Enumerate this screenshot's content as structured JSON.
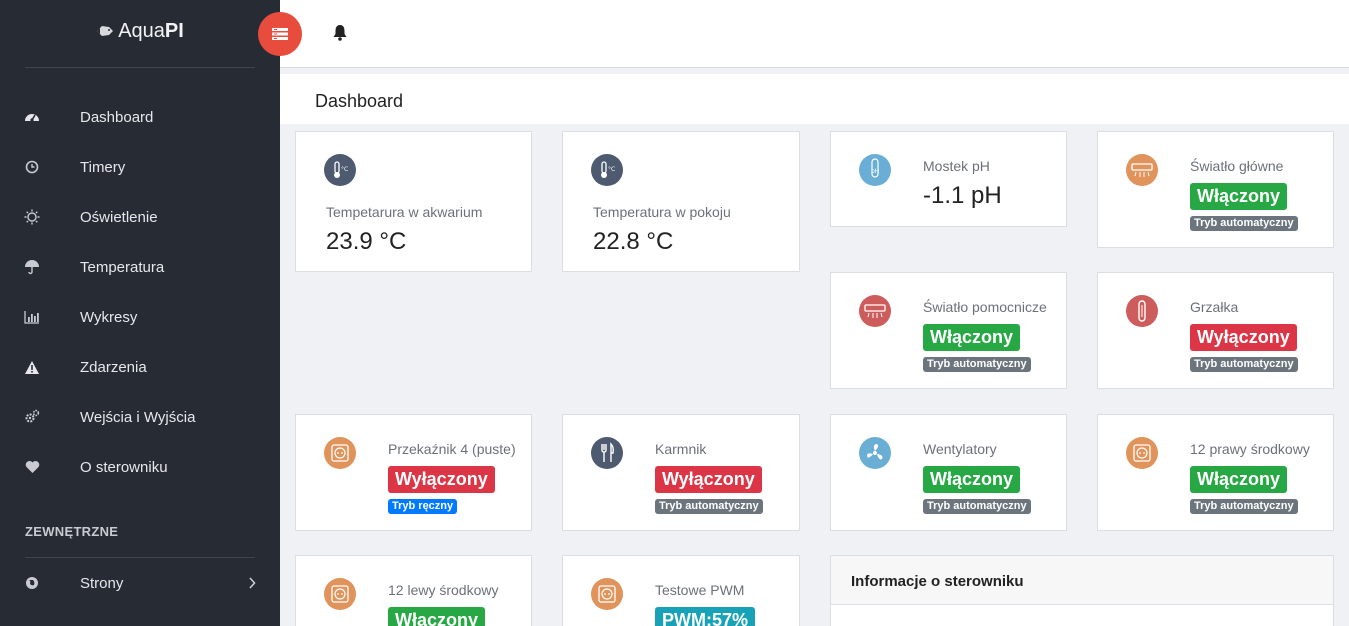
{
  "app": {
    "name_regular": "Aqua",
    "name_bold": "PI"
  },
  "sidebar": {
    "items": [
      {
        "label": "Dashboard",
        "icon": "gauge-icon"
      },
      {
        "label": "Timery",
        "icon": "clock-icon"
      },
      {
        "label": "Oświetlenie",
        "icon": "sun-icon"
      },
      {
        "label": "Temperatura",
        "icon": "umbrella-icon"
      },
      {
        "label": "Wykresy",
        "icon": "bar-chart-icon"
      },
      {
        "label": "Zdarzenia",
        "icon": "warning-icon"
      },
      {
        "label": "Wejścia i Wyjścia",
        "icon": "cogs-icon"
      },
      {
        "label": "O sterowniku",
        "icon": "heart-icon"
      }
    ],
    "section_title": "ZEWNĘTRZNE",
    "external_items": [
      {
        "label": "Strony",
        "icon": "globe-icon"
      }
    ]
  },
  "page": {
    "title": "Dashboard"
  },
  "colors": {
    "sidebar_bg": "#272b34",
    "accent": "#e74c3c",
    "on": "#28a745",
    "off": "#dc3545",
    "pwm": "#17a2b8",
    "mode_auto": "#6c757d",
    "mode_manual": "#007bff",
    "icon_slate": "#4e5a70",
    "icon_blue": "#6aaed6",
    "icon_orange": "#e0935a",
    "icon_red": "#cd5c5c"
  },
  "cards": {
    "temp_aquarium": {
      "label": "Tempetarura w akwarium",
      "value": "23.9 °C"
    },
    "temp_room": {
      "label": "Temperatura w pokoju",
      "value": "22.8 °C"
    },
    "ph": {
      "label": "Mostek pH",
      "value": "-1.1 pH"
    },
    "main_light": {
      "label": "Światło główne",
      "status": "Włączony",
      "mode": "Tryb automatyczny"
    },
    "aux_light": {
      "label": "Światło pomocnicze",
      "status": "Włączony",
      "mode": "Tryb automatyczny"
    },
    "heater": {
      "label": "Grzałka",
      "status": "Wyłączony",
      "mode": "Tryb automatyczny"
    },
    "relay4": {
      "label": "Przekaźnik 4 (puste)",
      "status": "Wyłączony",
      "mode": "Tryb ręczny"
    },
    "feeder": {
      "label": "Karmnik",
      "status": "Wyłączony",
      "mode": "Tryb automatyczny"
    },
    "fans": {
      "label": "Wentylatory",
      "status": "Włączony",
      "mode": "Tryb automatyczny"
    },
    "right12": {
      "label": "12 prawy środkowy",
      "status": "Włączony",
      "mode": "Tryb automatyczny"
    },
    "left12": {
      "label": "12 lewy środkowy",
      "status": "Włączony"
    },
    "pwm_test": {
      "label": "Testowe PWM",
      "status": "PWM:57%"
    }
  },
  "info": {
    "title": "Informacje o sterowniku"
  }
}
